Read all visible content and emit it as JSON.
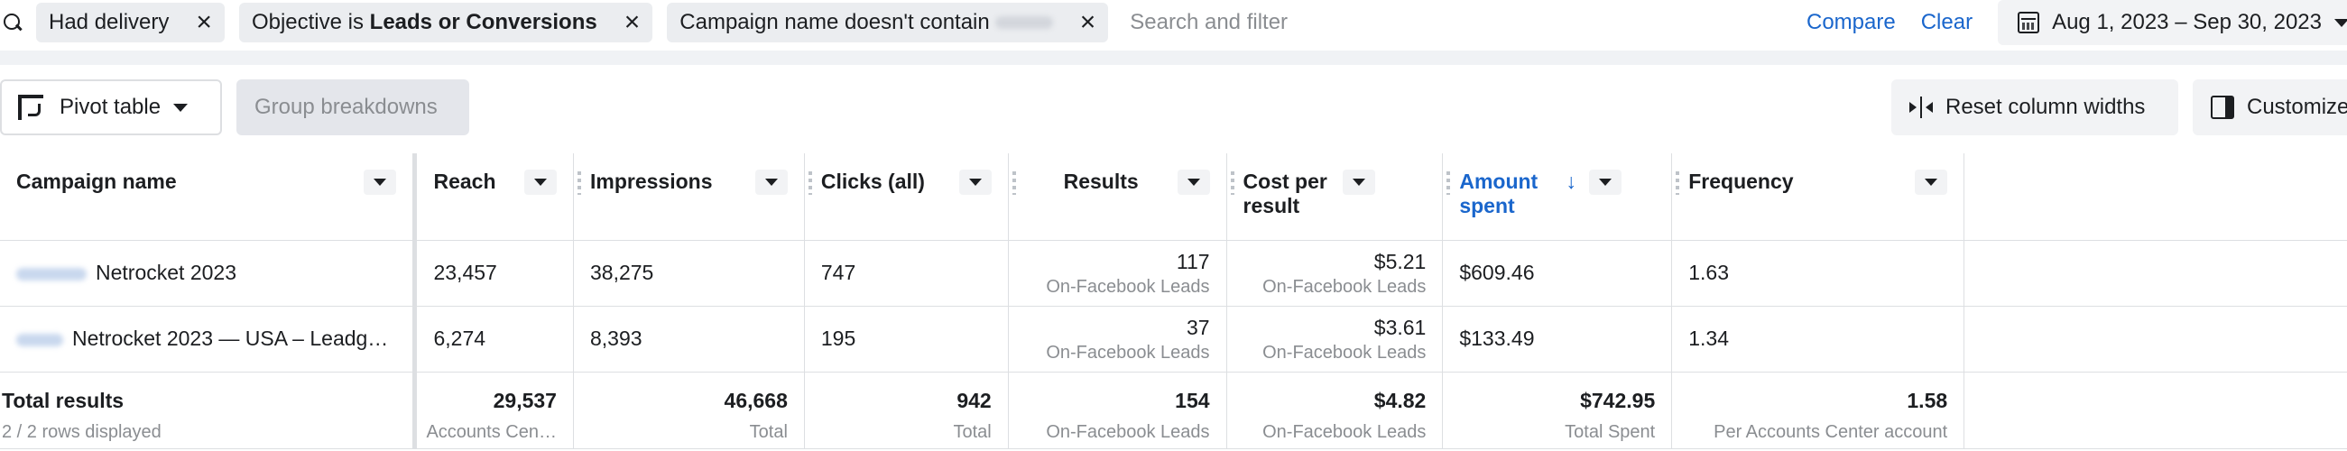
{
  "filters": {
    "chips": [
      {
        "label": "Had delivery"
      },
      {
        "prefix": "Objective is ",
        "bold": "Leads or Conversions"
      },
      {
        "label": "Campaign name doesn't contain"
      }
    ],
    "search_placeholder": "Search and filter",
    "compare_label": "Compare",
    "clear_label": "Clear",
    "date_range": "Aug 1, 2023 – Sep 30, 2023"
  },
  "toolbar": {
    "pivot_label": "Pivot table",
    "group_breakdowns_label": "Group breakdowns",
    "reset_widths_label": "Reset column widths",
    "customize_label": "Customize"
  },
  "columns": {
    "campaign": "Campaign name",
    "reach": "Reach",
    "impressions": "Impressions",
    "clicks": "Clicks (all)",
    "results": "Results",
    "cost_per_result": "Cost per result",
    "amount_spent": "Amount spent",
    "sort_arrow": "↓",
    "frequency": "Frequency"
  },
  "rows": [
    {
      "campaign": "Netrocket 2023",
      "reach": "23,457",
      "impressions": "38,275",
      "clicks": "747",
      "results": "117",
      "results_sub": "On-Facebook Leads",
      "cost": "$5.21",
      "cost_sub": "On-Facebook Leads",
      "spent": "$609.46",
      "frequency": "1.63"
    },
    {
      "campaign": "Netrocket 2023 — USA – Leadg…",
      "reach": "6,274",
      "impressions": "8,393",
      "clicks": "195",
      "results": "37",
      "results_sub": "On-Facebook Leads",
      "cost": "$3.61",
      "cost_sub": "On-Facebook Leads",
      "spent": "$133.49",
      "frequency": "1.34"
    }
  ],
  "totals": {
    "label": "Total results",
    "rows_displayed": "2 / 2 rows displayed",
    "reach": "29,537",
    "reach_sub": "Accounts Cen…",
    "impressions": "46,668",
    "impressions_sub": "Total",
    "clicks": "942",
    "clicks_sub": "Total",
    "results": "154",
    "results_sub": "On-Facebook Leads",
    "cost": "$4.82",
    "cost_sub": "On-Facebook Leads",
    "spent": "$742.95",
    "spent_sub": "Total Spent",
    "frequency": "1.58",
    "frequency_sub": "Per Accounts Center account"
  },
  "colors": {
    "accent": "#1a66cc",
    "chip_bg": "#ebedf0",
    "border": "#dddfe2",
    "muted_text": "#8a8d91"
  }
}
